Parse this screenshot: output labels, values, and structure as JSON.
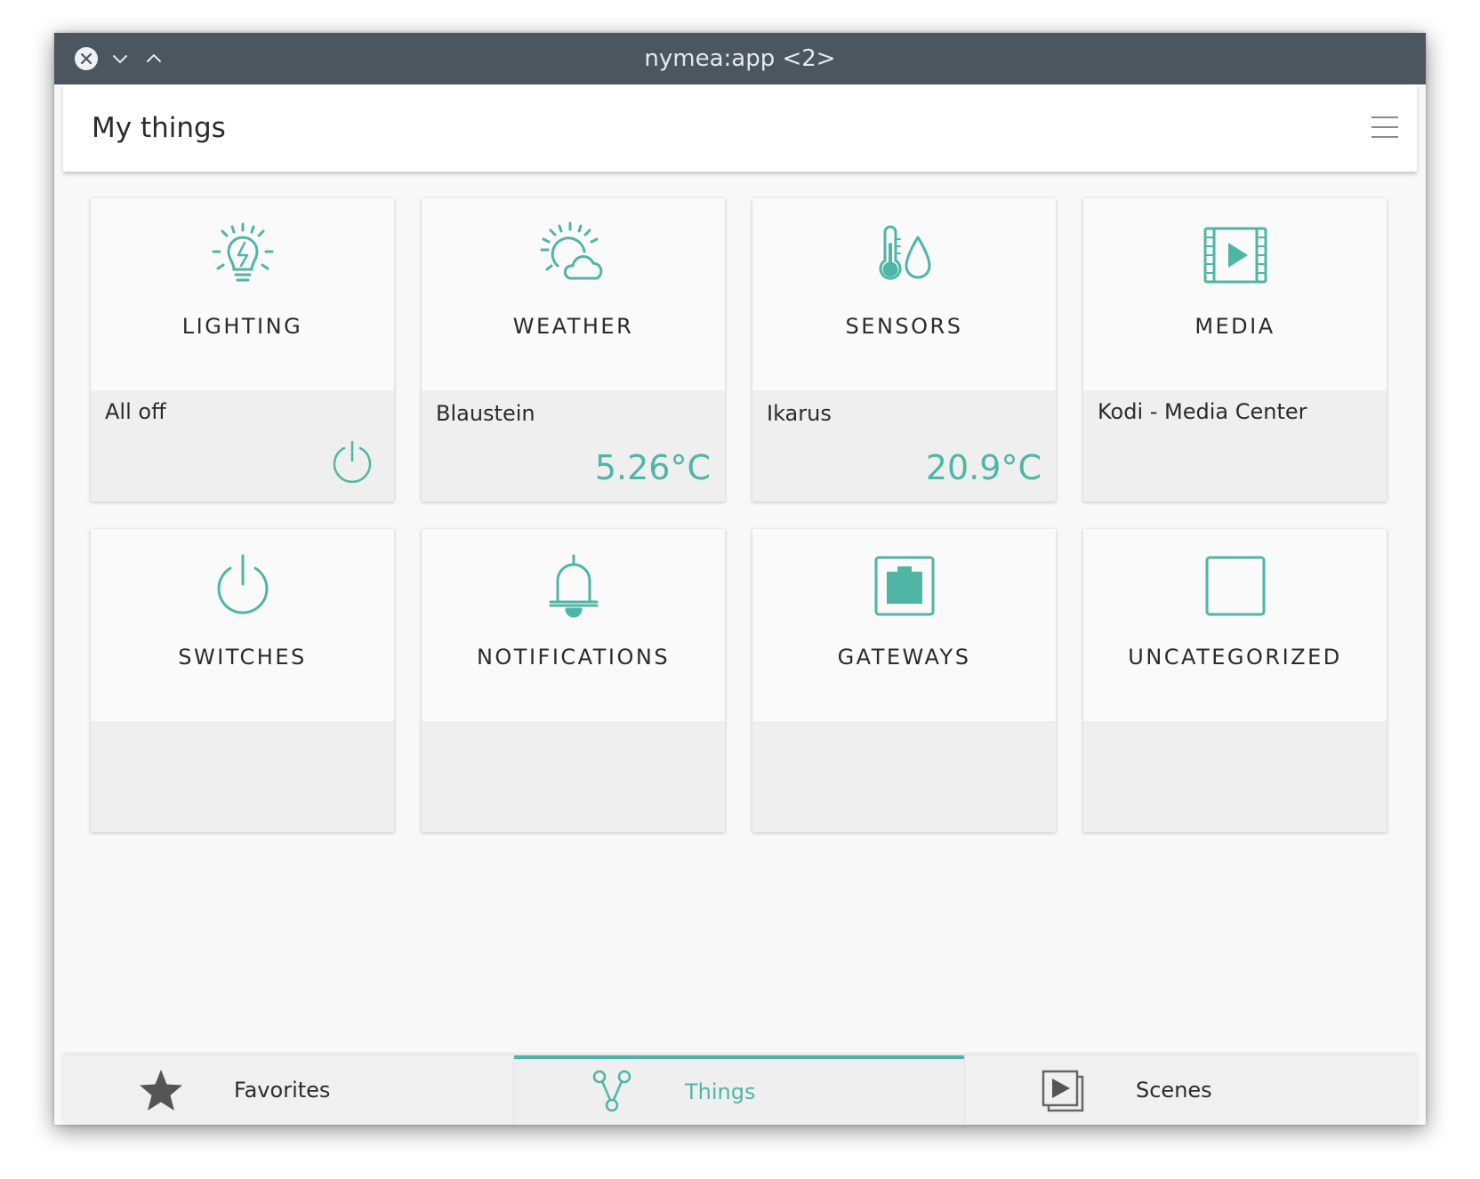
{
  "window": {
    "title": "nymea:app <2>"
  },
  "header": {
    "title": "My things"
  },
  "colors": {
    "accent": "#4fb6a5",
    "titlebar": "#4c565f"
  },
  "tiles": [
    {
      "label": "LIGHTING",
      "icon": "light-bulb-icon",
      "sub": "All off",
      "value": "",
      "action_icon": "power-icon"
    },
    {
      "label": "WEATHER",
      "icon": "weather-icon",
      "sub": "Blaustein",
      "value": "5.26°C"
    },
    {
      "label": "SENSORS",
      "icon": "sensors-icon",
      "sub": "Ikarus",
      "value": "20.9°C"
    },
    {
      "label": "MEDIA",
      "icon": "media-icon",
      "sub": "Kodi - Media Center",
      "value": ""
    },
    {
      "label": "SWITCHES",
      "icon": "power-icon",
      "sub": "",
      "value": ""
    },
    {
      "label": "NOTIFICATIONS",
      "icon": "bell-icon",
      "sub": "",
      "value": ""
    },
    {
      "label": "GATEWAYS",
      "icon": "gateway-icon",
      "sub": "",
      "value": ""
    },
    {
      "label": "UNCATEGORIZED",
      "icon": "uncategorized-icon",
      "sub": "",
      "value": ""
    }
  ],
  "tabs": [
    {
      "label": "Favorites",
      "icon": "star-icon",
      "active": false
    },
    {
      "label": "Things",
      "icon": "things-icon",
      "active": true
    },
    {
      "label": "Scenes",
      "icon": "scenes-icon",
      "active": false
    }
  ]
}
